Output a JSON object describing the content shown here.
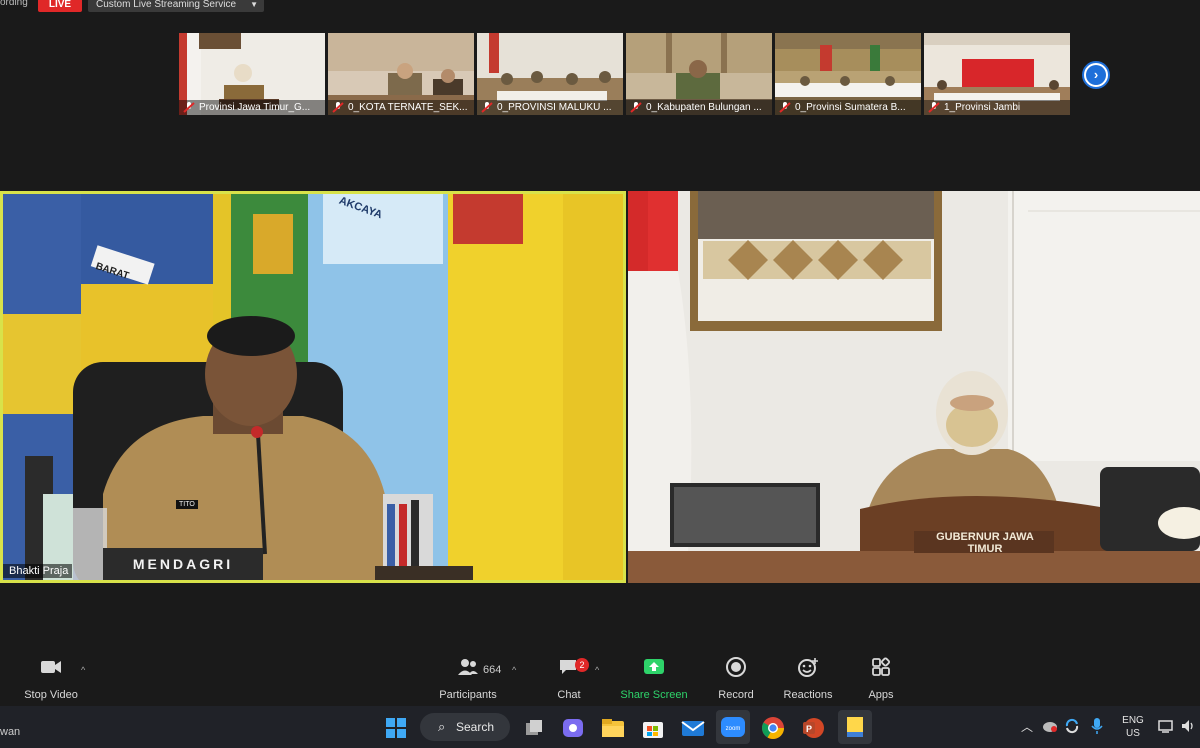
{
  "top_bar": {
    "recording_text": "ording",
    "live_badge": "LIVE",
    "stream_service": "Custom Live Streaming Service",
    "dropdown_icon": "caret-down-icon"
  },
  "gallery": {
    "thumbnails": [
      {
        "label": "Provinsi Jawa Timur_G..."
      },
      {
        "label": "0_KOTA TERNATE_SEK..."
      },
      {
        "label": "0_PROVINSI MALUKU ..."
      },
      {
        "label": "0_Kabupaten Bulungan ..."
      },
      {
        "label": "0_Provinsi Sumatera B..."
      },
      {
        "label": "1_Provinsi Jambi"
      }
    ],
    "next_page_icon": "chevron-right-icon"
  },
  "main_videos": {
    "left": {
      "participant_name": "Bhakti Praja",
      "nameplate": "MENDAGRI",
      "uniform_tag": "TITO",
      "flag_text": "AKCAYA",
      "flag_text_2": "BARAT"
    },
    "right": {
      "nameplate": "GUBERNUR JAWA TIMUR"
    }
  },
  "toolbar": {
    "stop_video": "Stop Video",
    "participants": "Participants",
    "participants_count": "664",
    "chat": "Chat",
    "chat_badge": "2",
    "share_screen": "Share Screen",
    "record": "Record",
    "reactions": "Reactions",
    "apps": "Apps",
    "share_color": "#2ed36a"
  },
  "taskbar": {
    "left_text": "wan",
    "search_label": "Search",
    "lang_line1": "ENG",
    "lang_line2": "US"
  }
}
